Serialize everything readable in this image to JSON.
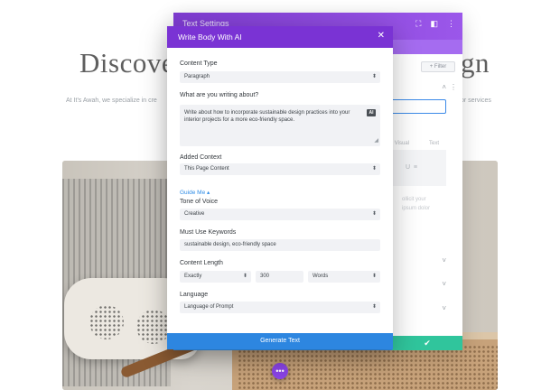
{
  "background": {
    "heading_left": "Discove",
    "heading_right": "gn",
    "subtitle_left": "At It's Awah, we specialize in cre",
    "subtitle_right": "or services"
  },
  "settings_panel": {
    "title": "Text Settings",
    "filter_label": "+ Filter",
    "tab_visual": "Visual",
    "tab_text": "Text",
    "faint_line1": "ollicit your",
    "faint_line2": "ipsum dolor",
    "save_icon": "✔"
  },
  "modal": {
    "title": "Write Body With AI",
    "close_icon": "✕",
    "content_type": {
      "label": "Content Type",
      "value": "Paragraph"
    },
    "about": {
      "label": "What are you writing about?",
      "value": "Write about how to incorporate sustainable design practices into your interior projects for a more eco-friendly space.",
      "ai_badge": "AI"
    },
    "added_context": {
      "label": "Added Context",
      "value": "This Page Content"
    },
    "guide_me": "Guide Me ▴",
    "tone": {
      "label": "Tone of Voice",
      "value": "Creative"
    },
    "keywords": {
      "label": "Must Use Keywords",
      "value": "sustainable design, eco-friendly space"
    },
    "length": {
      "label": "Content Length",
      "mode": "Exactly",
      "count": "300",
      "unit": "Words"
    },
    "language": {
      "label": "Language",
      "value": "Language of Prompt"
    },
    "generate_label": "Generate Text"
  },
  "fab_icon": "•••",
  "colors": {
    "accent_purple": "#7a33d4",
    "accent_blue": "#2d86e0",
    "save_green": "#30c59c"
  }
}
